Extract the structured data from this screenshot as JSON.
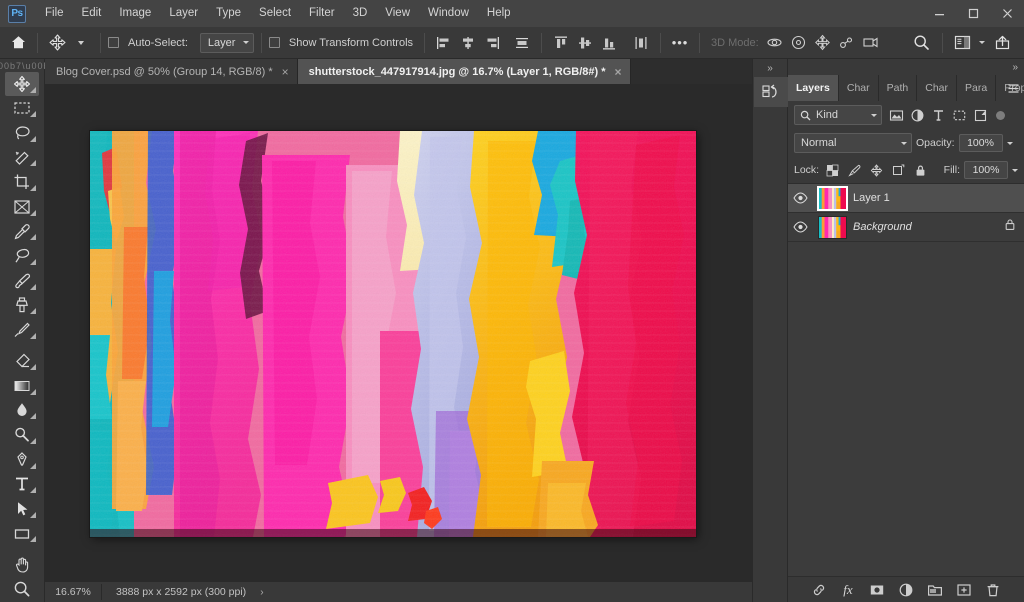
{
  "app": {
    "name": "Ps",
    "logo_label": "Ps"
  },
  "menubar": {
    "items": [
      {
        "label": "File"
      },
      {
        "label": "Edit"
      },
      {
        "label": "Image"
      },
      {
        "label": "Layer"
      },
      {
        "label": "Type"
      },
      {
        "label": "Select"
      },
      {
        "label": "Filter"
      },
      {
        "label": "3D"
      },
      {
        "label": "View"
      },
      {
        "label": "Window"
      },
      {
        "label": "Help"
      }
    ],
    "window_controls": [
      {
        "name": "minimize",
        "glyph": "–"
      },
      {
        "name": "maximize",
        "glyph": "□"
      },
      {
        "name": "close",
        "glyph": "✕"
      }
    ]
  },
  "options_bar": {
    "home_icon": "home-icon",
    "tool_icon": "move-tool-icon",
    "auto_select_label": "Auto-Select:",
    "auto_select_checked": false,
    "auto_select_scope": "Layer",
    "show_transform_label": "Show Transform Controls",
    "show_transform_checked": false,
    "align_left_icons": [
      "align-left-edges",
      "align-horizontal-centers",
      "align-right-edges"
    ],
    "distribute_icon": "distribute-horizontally",
    "align_top_icons": [
      "align-top-edges",
      "align-vertical-centers",
      "align-bottom-edges"
    ],
    "distribute_vertical_icon": "distribute-vertically",
    "more_label": "•••",
    "mode_3d_label": "3D Mode:",
    "mode_3d_icons": [
      "rotate-3d-icon",
      "roll-3d-icon",
      "pan-3d-icon",
      "slide-3d-icon",
      "scale-3d-icon"
    ],
    "search_icon": "search-icon",
    "workspace_icon": "workspace-icon",
    "share_icon": "share-icon"
  },
  "toolbar": {
    "tools": [
      {
        "name": "move-tool",
        "active": true
      },
      {
        "name": "rectangular-marquee-tool",
        "active": false
      },
      {
        "name": "lasso-tool",
        "active": false
      },
      {
        "name": "quick-selection-tool",
        "active": false
      },
      {
        "name": "crop-tool",
        "active": false
      },
      {
        "name": "frame-tool",
        "active": false
      },
      {
        "name": "eyedropper-tool",
        "active": false
      },
      {
        "name": "spot-healing-brush-tool",
        "active": false
      },
      {
        "name": "brush-tool",
        "active": false
      },
      {
        "name": "clone-stamp-tool",
        "active": false
      },
      {
        "name": "history-brush-tool",
        "active": false
      },
      {
        "name": "eraser-tool",
        "active": false
      },
      {
        "name": "gradient-tool",
        "active": false
      },
      {
        "name": "blur-tool",
        "active": false
      },
      {
        "name": "dodge-tool",
        "active": false
      },
      {
        "name": "pen-tool",
        "active": false
      },
      {
        "name": "type-tool",
        "active": false
      },
      {
        "name": "path-selection-tool",
        "active": false
      },
      {
        "name": "rectangle-tool",
        "active": false
      },
      {
        "name": "hand-tool",
        "active": false
      },
      {
        "name": "zoom-tool",
        "active": false
      }
    ]
  },
  "tabs": [
    {
      "title": "Blog Cover.psd @ 50% (Group 14, RGB/8) *",
      "active": false,
      "close_glyph": "×"
    },
    {
      "title": "shutterstock_447917914.jpg @ 16.7% (Layer 1, RGB/8#) *",
      "active": true,
      "close_glyph": "×"
    }
  ],
  "status_bar": {
    "zoom": "16.67%",
    "dimensions": "3888 px x 2592 px (300 ppi)",
    "arrow_glyph": "›"
  },
  "icon_dock": {
    "collapse_glyph": "»",
    "buttons": [
      {
        "name": "history-panel-icon"
      }
    ]
  },
  "layers_panel": {
    "collapse_glyph": "»",
    "menu_glyph": "≡",
    "tabs": [
      {
        "label": "Layers",
        "active": true
      },
      {
        "label": "Char",
        "active": false
      },
      {
        "label": "Path",
        "active": false
      },
      {
        "label": "Char",
        "active": false
      },
      {
        "label": "Para",
        "active": false
      },
      {
        "label": "Prop",
        "active": false
      }
    ],
    "filter": {
      "kind_label": "Kind",
      "search_icon": "search-icon",
      "type_icons": [
        "filter-pixel-icon",
        "filter-adjustment-icon",
        "filter-type-icon",
        "filter-shape-icon",
        "filter-smart-object-icon"
      ],
      "toggle_name": "filter-enable-toggle"
    },
    "blend_mode": "Normal",
    "opacity_label": "Opacity:",
    "opacity_value": "100%",
    "lock_label": "Lock:",
    "lock_icons": [
      "lock-transparent-pixels-icon",
      "lock-image-pixels-icon",
      "lock-position-icon",
      "lock-artboard-nesting-icon",
      "lock-all-icon"
    ],
    "fill_label": "Fill:",
    "fill_value": "100%",
    "layers": [
      {
        "name": "Layer 1",
        "visible": true,
        "selected": true,
        "locked": false,
        "italic": false
      },
      {
        "name": "Background",
        "visible": true,
        "selected": false,
        "locked": true,
        "italic": true
      }
    ],
    "footer_buttons": [
      {
        "name": "link-layers-button",
        "label": "link"
      },
      {
        "name": "layer-style-button",
        "label": "fx"
      },
      {
        "name": "add-layer-mask-button",
        "label": "mask"
      },
      {
        "name": "new-adjustment-layer-button",
        "label": "adjustment"
      },
      {
        "name": "new-group-button",
        "label": "group"
      },
      {
        "name": "new-layer-button",
        "label": "new"
      },
      {
        "name": "delete-layer-button",
        "label": "delete"
      }
    ]
  },
  "canvas": {
    "document_name": "shutterstock_447917914.jpg",
    "artwork_description": "Abstract vibrant acrylic paint strokes"
  }
}
